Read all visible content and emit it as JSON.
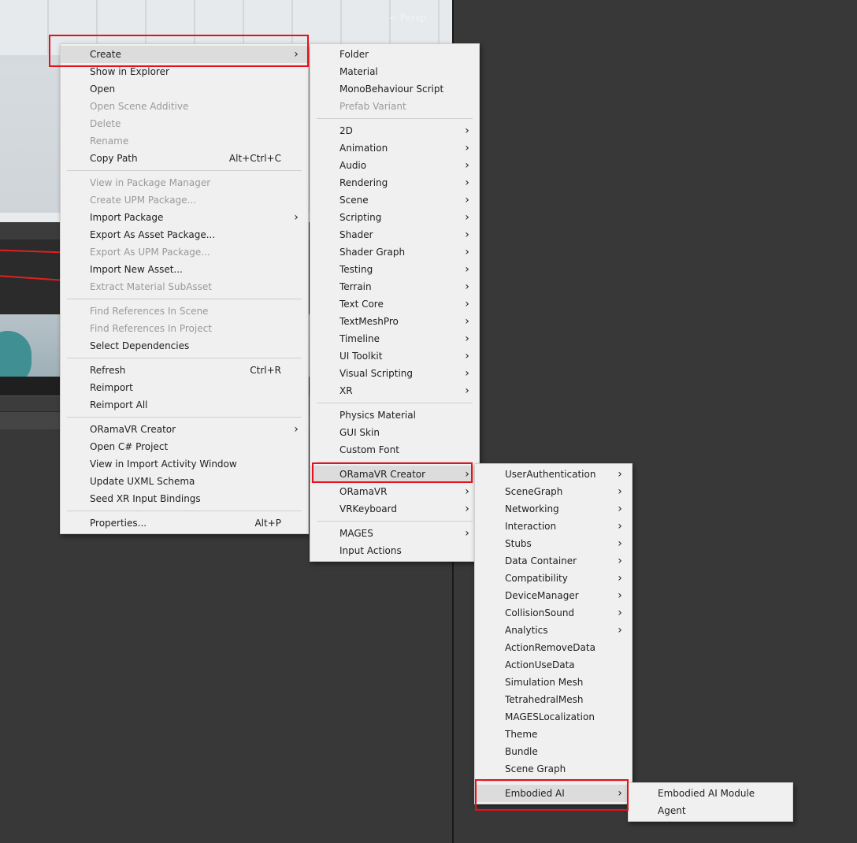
{
  "scene_view": {
    "persp_label": "< Persp"
  },
  "context_menu": {
    "items": [
      {
        "label": "Create",
        "submenu": true,
        "highlighted": true
      },
      {
        "label": "Show in Explorer"
      },
      {
        "label": "Open"
      },
      {
        "label": "Open Scene Additive",
        "disabled": true
      },
      {
        "label": "Delete",
        "disabled": true
      },
      {
        "label": "Rename",
        "disabled": true
      },
      {
        "label": "Copy Path",
        "shortcut": "Alt+Ctrl+C"
      },
      {
        "separator": true
      },
      {
        "label": "View in Package Manager",
        "disabled": true
      },
      {
        "label": "Create UPM Package...",
        "disabled": true
      },
      {
        "label": "Import Package",
        "submenu": true
      },
      {
        "label": "Export As Asset Package..."
      },
      {
        "label": "Export As UPM Package...",
        "disabled": true
      },
      {
        "label": "Import New Asset..."
      },
      {
        "label": "Extract Material SubAsset",
        "disabled": true
      },
      {
        "separator": true
      },
      {
        "label": "Find References In Scene",
        "disabled": true
      },
      {
        "label": "Find References In Project",
        "disabled": true
      },
      {
        "label": "Select Dependencies"
      },
      {
        "separator": true
      },
      {
        "label": "Refresh",
        "shortcut": "Ctrl+R"
      },
      {
        "label": "Reimport"
      },
      {
        "label": "Reimport All"
      },
      {
        "separator": true
      },
      {
        "label": "ORamaVR Creator",
        "submenu": true
      },
      {
        "label": "Open C# Project"
      },
      {
        "label": "View in Import Activity Window"
      },
      {
        "label": "Update UXML Schema"
      },
      {
        "label": "Seed XR Input Bindings"
      },
      {
        "separator": true
      },
      {
        "label": "Properties...",
        "shortcut": "Alt+P"
      }
    ]
  },
  "create_menu": {
    "items": [
      {
        "label": "Folder"
      },
      {
        "label": "Material"
      },
      {
        "label": "MonoBehaviour Script"
      },
      {
        "label": "Prefab Variant",
        "disabled": true
      },
      {
        "separator": true
      },
      {
        "label": "2D",
        "submenu": true
      },
      {
        "label": "Animation",
        "submenu": true
      },
      {
        "label": "Audio",
        "submenu": true
      },
      {
        "label": "Rendering",
        "submenu": true
      },
      {
        "label": "Scene",
        "submenu": true
      },
      {
        "label": "Scripting",
        "submenu": true
      },
      {
        "label": "Shader",
        "submenu": true
      },
      {
        "label": "Shader Graph",
        "submenu": true
      },
      {
        "label": "Testing",
        "submenu": true
      },
      {
        "label": "Terrain",
        "submenu": true
      },
      {
        "label": "Text Core",
        "submenu": true
      },
      {
        "label": "TextMeshPro",
        "submenu": true
      },
      {
        "label": "Timeline",
        "submenu": true
      },
      {
        "label": "UI Toolkit",
        "submenu": true
      },
      {
        "label": "Visual Scripting",
        "submenu": true
      },
      {
        "label": "XR",
        "submenu": true
      },
      {
        "separator": true
      },
      {
        "label": "Physics Material"
      },
      {
        "label": "GUI Skin"
      },
      {
        "label": "Custom Font"
      },
      {
        "separator": true
      },
      {
        "label": "ORamaVR Creator",
        "submenu": true,
        "highlighted": true
      },
      {
        "label": "ORamaVR",
        "submenu": true
      },
      {
        "label": "VRKeyboard",
        "submenu": true
      },
      {
        "separator": true
      },
      {
        "label": "MAGES",
        "submenu": true
      },
      {
        "label": "Input Actions"
      }
    ]
  },
  "oramavr_creator_menu": {
    "items": [
      {
        "label": "UserAuthentication",
        "submenu": true
      },
      {
        "label": "SceneGraph",
        "submenu": true
      },
      {
        "label": "Networking",
        "submenu": true
      },
      {
        "label": "Interaction",
        "submenu": true
      },
      {
        "label": "Stubs",
        "submenu": true
      },
      {
        "label": "Data Container",
        "submenu": true
      },
      {
        "label": "Compatibility",
        "submenu": true
      },
      {
        "label": "DeviceManager",
        "submenu": true
      },
      {
        "label": "CollisionSound",
        "submenu": true
      },
      {
        "label": "Analytics",
        "submenu": true
      },
      {
        "label": "ActionRemoveData"
      },
      {
        "label": "ActionUseData"
      },
      {
        "label": "Simulation Mesh"
      },
      {
        "label": "TetrahedralMesh"
      },
      {
        "label": "MAGESLocalization"
      },
      {
        "label": "Theme"
      },
      {
        "label": "Bundle"
      },
      {
        "label": "Scene Graph"
      },
      {
        "separator": true
      },
      {
        "label": "Embodied AI",
        "submenu": true,
        "highlighted": true
      }
    ]
  },
  "embodied_ai_menu": {
    "items": [
      {
        "label": "Embodied AI Module"
      },
      {
        "label": "Agent"
      }
    ]
  },
  "colors": {
    "highlight_box": "#e8101a",
    "menu_bg": "#f0f0f0",
    "disabled_text": "#9a9a9a"
  }
}
